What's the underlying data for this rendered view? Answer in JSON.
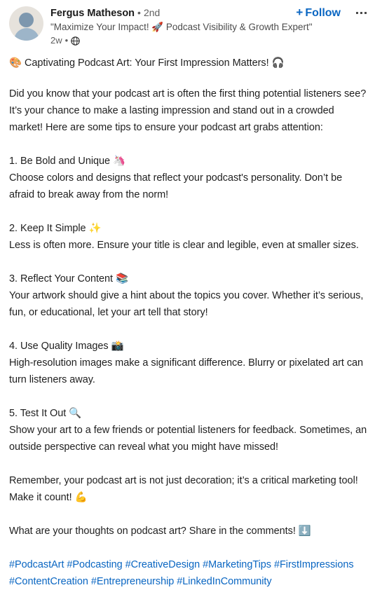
{
  "author": {
    "name": "Fergus Matheson",
    "separator": "•",
    "degree": "2nd",
    "headline": "\"Maximize Your Impact! 🚀 Podcast Visibility & Growth Expert\"",
    "timestamp": "2w",
    "meta_separator": "•",
    "visibility_icon": "globe-icon",
    "avatar_alt": "default-profile-photo"
  },
  "actions": {
    "follow_label": "Follow",
    "follow_plus": "+",
    "more_label": "more-options"
  },
  "colors": {
    "link_blue": "#0a66c2",
    "text_primary": "#1f1f1f",
    "text_secondary": "#5f5f5f"
  },
  "post": {
    "title": "🎨 Captivating Podcast Art: Your First Impression Matters! 🎧",
    "intro": "Did you know that your podcast art is often the first thing potential listeners see? It’s your chance to make a lasting impression and stand out in a crowded market! Here are some tips to ensure your podcast art grabs attention:",
    "tips": [
      {
        "heading": "1. Be Bold and Unique 🦄",
        "body": "Choose colors and designs that reflect your podcast's personality. Don’t be afraid to break away from the norm!"
      },
      {
        "heading": "2. Keep It Simple ✨",
        "body": "Less is often more. Ensure your title is clear and legible, even at smaller sizes."
      },
      {
        "heading": "3. Reflect Your Content 📚",
        "body": "Your artwork should give a hint about the topics you cover. Whether it’s serious, fun, or educational, let your art tell that story!"
      },
      {
        "heading": "4. Use Quality Images 📸",
        "body": "High-resolution images make a significant difference. Blurry or pixelated art can turn listeners away."
      },
      {
        "heading": "5. Test It Out 🔍",
        "body": "Show your art to a few friends or potential listeners for feedback. Sometimes, an outside perspective can reveal what you might have missed!"
      }
    ],
    "closing": "Remember, your podcast art is not just decoration; it’s a critical marketing tool! Make it count! 💪",
    "call_to_action": "What are your thoughts on podcast art? Share in the comments! ⬇️",
    "hashtags": [
      "#PodcastArt",
      "#Podcasting",
      "#CreativeDesign",
      "#MarketingTips",
      "#FirstImpressions",
      "#ContentCreation",
      "#Entrepreneurship",
      "#LinkedInCommunity"
    ]
  }
}
